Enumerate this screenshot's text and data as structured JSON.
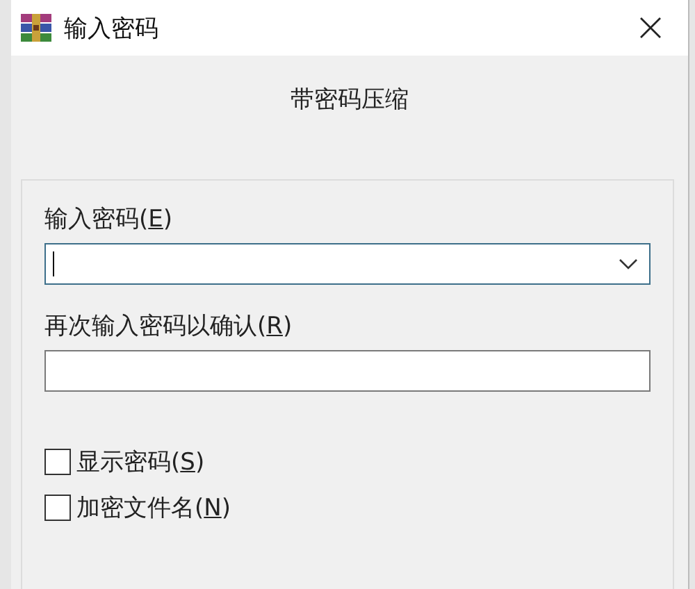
{
  "window": {
    "title": "输入密码"
  },
  "heading": "带密码压缩",
  "fields": [
    {
      "kind": "combo",
      "label": "输入密码(E)",
      "focused": true
    },
    {
      "kind": "text",
      "label": "再次输入密码以确认(R)",
      "focused": false
    }
  ],
  "checkboxes": [
    {
      "label": "显示密码(S)",
      "checked": false
    },
    {
      "label": "加密文件名(N)",
      "checked": false
    }
  ]
}
